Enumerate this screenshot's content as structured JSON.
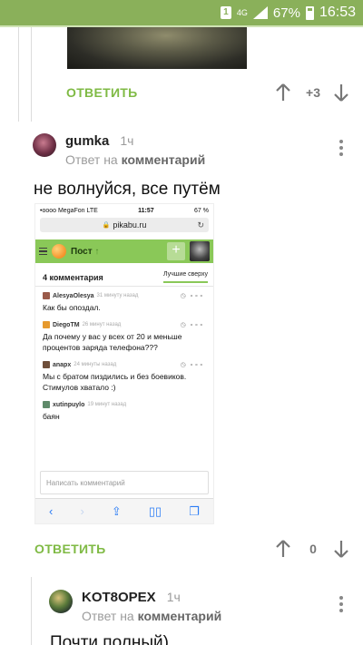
{
  "status_bar": {
    "sim_label": "1",
    "network_label": "4G",
    "battery": "67%",
    "time": "16:53"
  },
  "top_comment": {
    "reply_label": "ОТВЕТИТЬ",
    "score": "+3"
  },
  "comment_gumka": {
    "author": "gumka",
    "ago": "1ч",
    "reply_prefix": "Ответ на",
    "reply_target": "комментарий",
    "text": "не волнуйся, все путём",
    "reply_label": "ОТВЕТИТЬ",
    "score": "0"
  },
  "embedded_screenshot": {
    "carrier": "•oooo MegaFon  LTE",
    "time": "11:57",
    "battery": "67 %",
    "url": "pikabu.ru",
    "post_title": "Пост",
    "comments_count": "4 комментария",
    "sort_label": "Лучшие сверху",
    "comments": [
      {
        "author": "AlesyaOlesya",
        "ago": "31 минуту назад",
        "text": "Как бы опоздал.",
        "avatar_color": "#9a5a4a"
      },
      {
        "author": "DiegoTM",
        "ago": "26 минут назад",
        "text": "Да почему у вас у всех от 20 и меньше процентов заряда телефона???",
        "avatar_color": "#e69a2e"
      },
      {
        "author": "anapx",
        "ago": "24 минуты назад",
        "text": "Мы с братом пиздились и без боевиков. Стимулов хватало :)",
        "avatar_color": "#6e4e3a"
      },
      {
        "author": "xutinpuylo",
        "ago": "19 минут назад",
        "text": "баян",
        "avatar_color": "#5f8a6a"
      }
    ],
    "compose_placeholder": "Написать комментарий"
  },
  "comment_kot8opex": {
    "author": "KOT8OPEX",
    "ago": "1ч",
    "reply_prefix": "Ответ на",
    "reply_target": "комментарий",
    "text": "Почти полный)"
  },
  "colors": {
    "accent_green": "#7fba44",
    "status_bar_green": "#8ab05a"
  }
}
